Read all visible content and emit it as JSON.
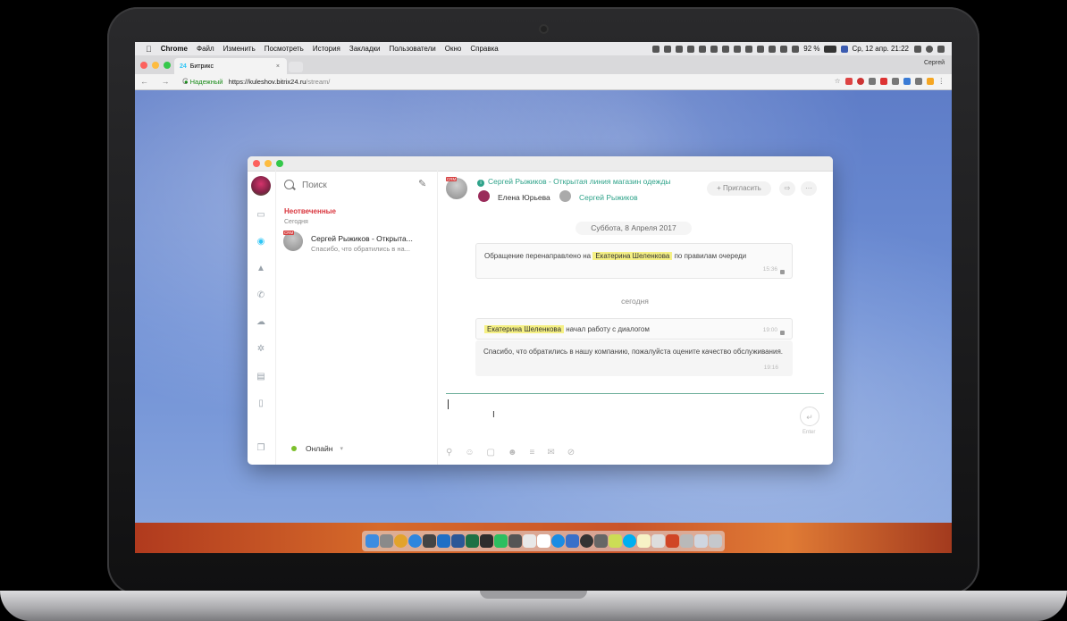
{
  "menubar": {
    "apple_icon": "apple-icon",
    "app_name": "Chrome",
    "items": [
      "Файл",
      "Изменить",
      "Посмотреть",
      "История",
      "Закладки",
      "Пользователи",
      "Окно",
      "Справка"
    ],
    "battery": "92 %",
    "datetime": "Ср, 12 апр.  21:22"
  },
  "browser": {
    "tab_favicon": "24",
    "tab_title": "Битрикс",
    "tab_close": "×",
    "profile": "Сергей",
    "secure_label": "Надежный",
    "url_host": "https://kuleshov.bitrix24.ru",
    "url_path": "/stream/",
    "nav": "← → C"
  },
  "messenger": {
    "search_placeholder": "Поиск",
    "section_title": "Неотвеченные",
    "section_date": "Сегодня",
    "recent": [
      {
        "badge": "CRM",
        "name": "Сергей Рыжиков - Открыта...",
        "preview": "Спасибо, что обратились в на..."
      }
    ],
    "status": "Онлайн",
    "status_chevron": "▾"
  },
  "chat": {
    "badge": "CRM",
    "info_icon": "i",
    "title": "Сергей Рыжиков - Открытая линия магазин одежды",
    "members": [
      "Елена Юрьева",
      "Сергей Рыжиков"
    ],
    "invite_label": "+ Пригласить",
    "forward_icon": "⇨",
    "more_icon": "···",
    "day1": "Суббота, 8 Апреля 2017",
    "sys1": {
      "before": "Обращение перенаправлено на ",
      "highlight": "Екатерина Шеленкова",
      "after": " по правилам очереди",
      "time": "15:36"
    },
    "day2": "сегодня",
    "msg2": {
      "highlight": "Екатерина Шеленкова",
      "text": " начал работу с диалогом",
      "time": "19:00"
    },
    "msg3": {
      "text": "Спасибо, что обратились в нашу компанию, пожалуйста оцените качество обслуживания.",
      "time": "19:16"
    },
    "input_value": "",
    "send_label": "Enter",
    "send_icon": "↵",
    "toolbar_icons": [
      "attach-icon",
      "user-icon",
      "quote-icon",
      "smile-icon",
      "template-icon",
      "chat-icon",
      "hide-icon"
    ]
  },
  "colors": {
    "accent_teal": "#2fa38a",
    "unanswered_red": "#d9353d",
    "highlight_yellow": "#f5f084",
    "bitrix_blue": "#2fc6f6",
    "online_green": "#7cc02c"
  }
}
